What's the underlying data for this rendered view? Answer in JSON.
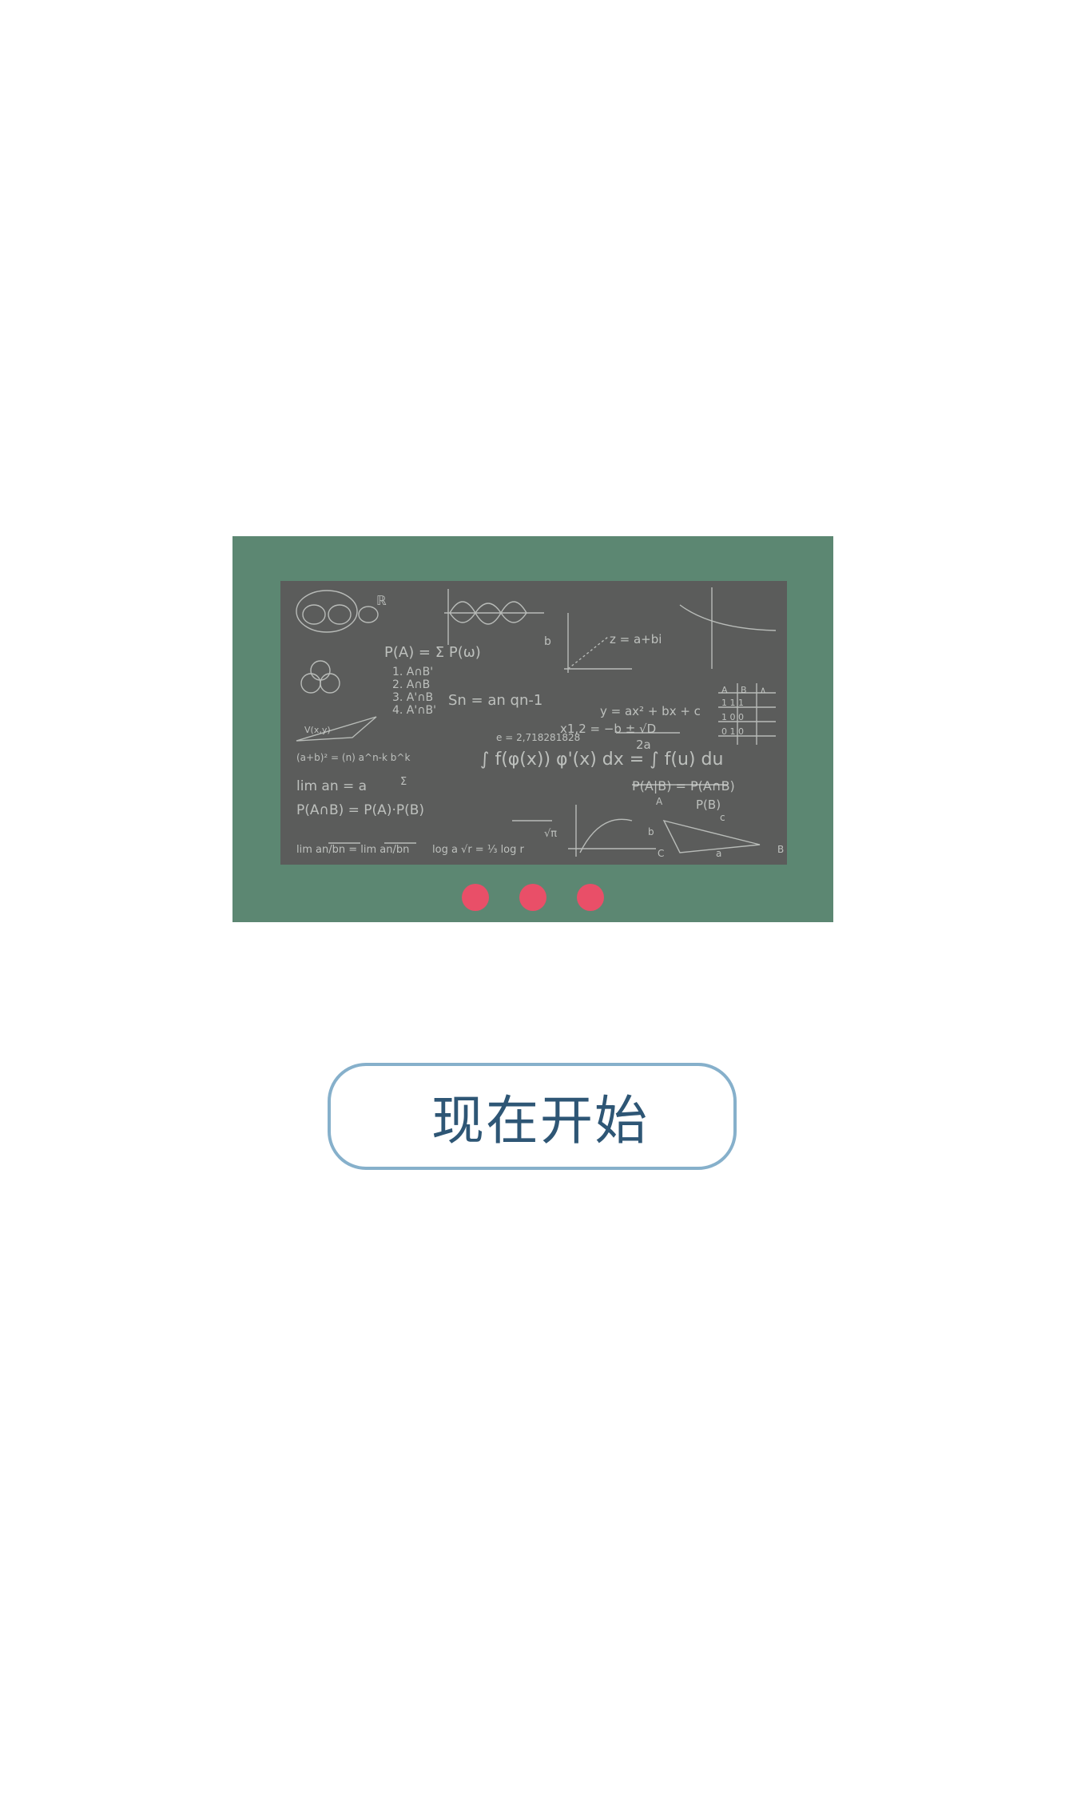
{
  "start_button": {
    "label": "现在开始"
  },
  "illustration": {
    "icon": "chalkboard-math-illustration",
    "dots_count": 3,
    "colors": {
      "frame": "#5c8772",
      "board": "#5b5c5b",
      "chalk": "#cfd2cf",
      "dot": "#e94f68"
    },
    "formulas": [
      "P(A) = Σ P(ω)",
      "1. A∩B'",
      "2. A∩B",
      "3. A'∩B",
      "4. A'∩B'",
      "Sn = an  qn-1",
      "z = a+bi",
      "y = ax² + bx + c",
      "∫ f(φ(x)) φ'(x) dx = ∫ f(u) du",
      "x1,2 = −b ± √D",
      "2a",
      "e = 2,718281828",
      "lim an = a",
      "P(A|B) = P(A∩B)",
      "P(B)",
      "P(A∩B) = P(A)·P(B)",
      "A",
      "B",
      "C",
      "a",
      "b",
      "c"
    ]
  },
  "accent_colors": {
    "button_border": "#86b0cb",
    "button_text": "#2e5675"
  }
}
